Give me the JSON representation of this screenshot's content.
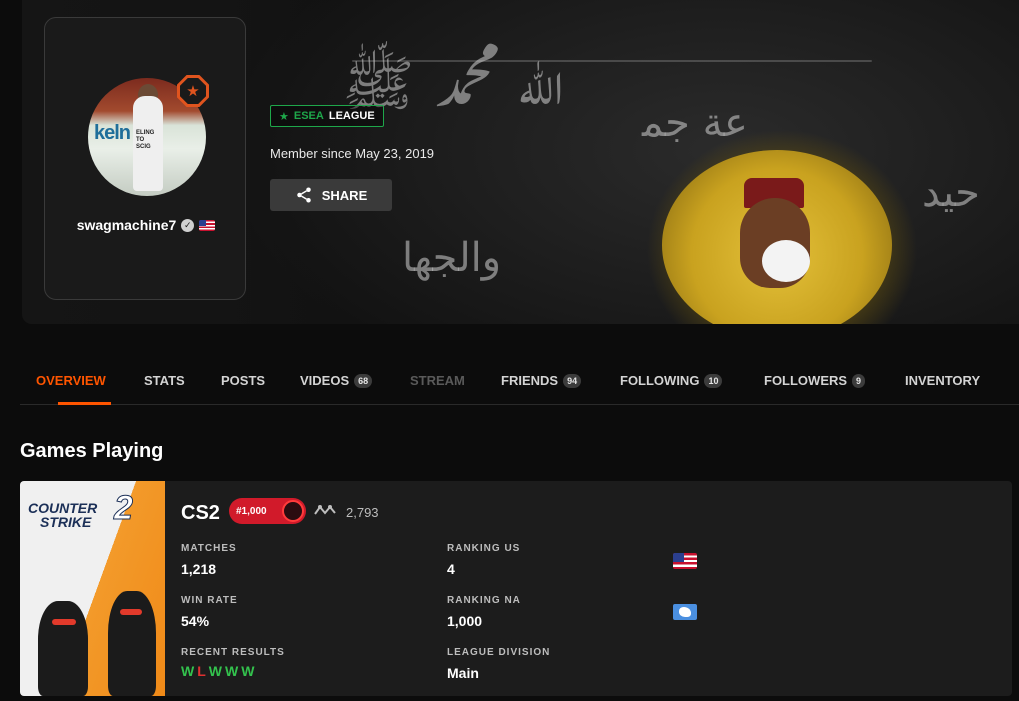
{
  "profile": {
    "username": "swagmachine7",
    "member_since": "Member since May 23, 2019",
    "share_label": "SHARE",
    "esea": {
      "prefix": "ESEA",
      "suffix": "LEAGUE"
    },
    "avatar_shirt_text": "ELING\nTO\nSCIG",
    "avatar_banner_text": "keln"
  },
  "tabs": [
    {
      "label": "OVERVIEW",
      "state": "active"
    },
    {
      "label": "STATS"
    },
    {
      "label": "POSTS"
    },
    {
      "label": "VIDEOS",
      "count": "68"
    },
    {
      "label": "STREAM",
      "state": "disabled"
    },
    {
      "label": "FRIENDS",
      "count": "94"
    },
    {
      "label": "FOLLOWING",
      "count": "10"
    },
    {
      "label": "FOLLOWERS",
      "count": "9"
    },
    {
      "label": "INVENTORY"
    }
  ],
  "games_section": {
    "title": "Games Playing"
  },
  "game": {
    "name": "CS2",
    "logo_line1": "COUNTER",
    "logo_line2": "STRIKE",
    "logo_number": "2",
    "rank_badge": "#1,000",
    "elo": "2,793",
    "matches_label": "MATCHES",
    "matches": "1,218",
    "win_rate_label": "WIN RATE",
    "win_rate": "54%",
    "recent_results_label": "RECENT RESULTS",
    "recent_results": [
      "W",
      "L",
      "W",
      "W",
      "W"
    ],
    "ranking_us_label": "RANKING US",
    "ranking_us": "4",
    "ranking_na_label": "RANKING NA",
    "ranking_na": "1,000",
    "league_division_label": "LEAGUE DIVISION",
    "league_division": "Main"
  },
  "colors": {
    "accent": "#ff5500",
    "esea_green": "#1ea74a",
    "win": "#33c24d",
    "loss": "#e03030",
    "rank_red": "#d11a2a"
  },
  "icons": [
    "verified-icon",
    "us-flag-icon",
    "share-icon",
    "star-icon",
    "level-badge-icon",
    "elo-icon",
    "na-region-icon"
  ]
}
